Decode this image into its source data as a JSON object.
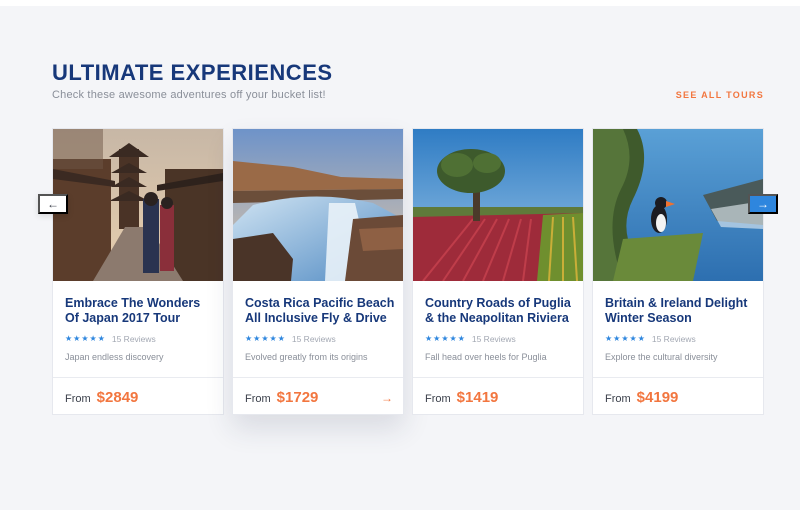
{
  "section": {
    "title": "ULTIMATE EXPERIENCES",
    "subtitle": "Check these awesome adventures off your bucket list!",
    "see_all": "SEE ALL TOURS"
  },
  "carousel": {
    "prev_icon": "←",
    "next_icon": "→"
  },
  "tours": [
    {
      "title": "Embrace The Wonders Of Japan 2017 Tour",
      "stars": "★★★★★",
      "reviews": "15 Reviews",
      "description": "Japan endless discovery",
      "from_label": "From",
      "price": "$2849",
      "image": "japan-street-pagoda"
    },
    {
      "title": "Costa Rica Pacific Beach All Inclusive Fly & Drive",
      "stars": "★★★★★",
      "reviews": "15 Reviews",
      "description": "Evolved greatly from its origins",
      "from_label": "From",
      "price": "$1729",
      "arrow": "→",
      "image": "waterfall-canyon"
    },
    {
      "title": "Country Roads of Puglia & the Neapolitan Riviera",
      "stars": "★★★★★",
      "reviews": "15 Reviews",
      "description": "Fall head over heels for Puglia",
      "from_label": "From",
      "price": "$1419",
      "image": "olive-tree-field"
    },
    {
      "title": "Britain & Ireland Delight Winter Season",
      "stars": "★★★★★",
      "reviews": "15 Reviews",
      "description": "Explore the cultural diversity",
      "from_label": "From",
      "price": "$4199",
      "image": "puffin-cliff"
    }
  ],
  "colors": {
    "title": "#17387a",
    "accent": "#f2763f",
    "star": "#2e86de",
    "next_button": "#2e86de",
    "background": "#f4f5f8"
  }
}
